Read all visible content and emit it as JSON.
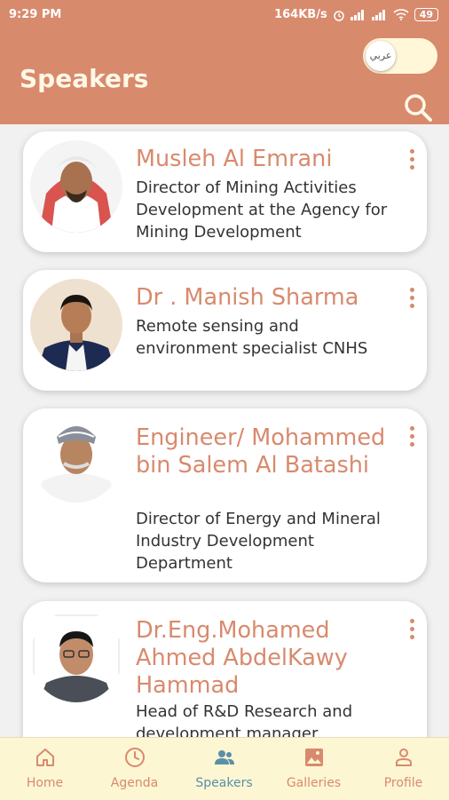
{
  "status_bar": {
    "time": "9:29 PM",
    "speed": "164KB/s",
    "battery": "49"
  },
  "header": {
    "title": "Speakers",
    "lang_toggle": "عربي"
  },
  "speakers": [
    {
      "name": "Musleh Al Emrani",
      "description": "Director of Mining Activities Development at the Agency for Mining Development"
    },
    {
      "name": "Dr . Manish Sharma",
      "description": "Remote sensing and environment specialist CNHS"
    },
    {
      "name": "Engineer/ Mohammed bin Salem Al Batashi",
      "description": "Director of Energy and Mineral Industry Development Department"
    },
    {
      "name": "Dr.Eng.Mohamed Ahmed AbdelKawy Hammad",
      "description": "Head of R&D Research and development manager"
    }
  ],
  "nav": [
    {
      "label": "Home",
      "icon": "home-icon"
    },
    {
      "label": "Agenda",
      "icon": "clock-icon"
    },
    {
      "label": "Speakers",
      "icon": "people-icon",
      "active": true
    },
    {
      "label": "Galleries",
      "icon": "image-icon"
    },
    {
      "label": "Profile",
      "icon": "person-icon"
    }
  ],
  "colors": {
    "primary": "#d88a6d",
    "nav_bg": "#fdf6d3",
    "active": "#5a8fa8"
  }
}
